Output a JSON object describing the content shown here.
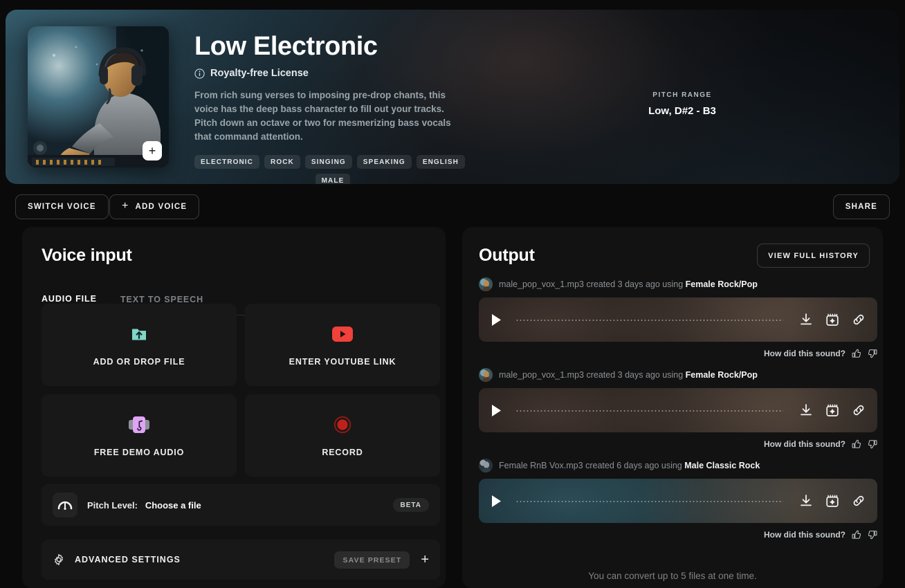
{
  "hero": {
    "cover_image_alt": "dj-producer-portrait",
    "cover_add_icon": "plus-icon",
    "title": "Low Electronic",
    "license_icon": "info-icon",
    "license": "Royalty-free License",
    "description": "From rich sung verses to imposing pre-drop chants, this voice has the deep bass character to fill out your tracks. Pitch down an octave or two for mesmerizing bass vocals that command attention.",
    "tags": [
      "ELECTRONIC",
      "ROCK",
      "SINGING",
      "SPEAKING",
      "ENGLISH"
    ],
    "tags_second_row": [
      "MALE"
    ],
    "pitch_range_label": "PITCH RANGE",
    "pitch_range_value": "Low, D#2 - B3"
  },
  "actions": {
    "switch_voice": "SWITCH VOICE",
    "add_voice": "ADD VOICE",
    "add_voice_icon": "plus-icon",
    "share": "SHARE"
  },
  "voice_input": {
    "title": "Voice input",
    "tabs": [
      {
        "label": "AUDIO FILE",
        "active": true
      },
      {
        "label": "TEXT TO SPEECH",
        "active": false
      }
    ],
    "cards": [
      {
        "label": "ADD OR DROP FILE",
        "icon": "upload-folder-icon",
        "color": "#7fd6c8"
      },
      {
        "label": "ENTER YOUTUBE LINK",
        "icon": "youtube-icon",
        "color": "#f0413a"
      },
      {
        "label": "FREE DEMO AUDIO",
        "icon": "cassette-music-icon",
        "color": "#dfa4f5"
      },
      {
        "label": "RECORD",
        "icon": "record-icon",
        "color": "#c0201a"
      }
    ],
    "pitch_level": {
      "icon": "gauge-icon",
      "label": "Pitch Level:",
      "value": "Choose a file",
      "badge": "BETA"
    },
    "advanced_settings": {
      "icon": "gear-icon",
      "label": "ADVANCED SETTINGS",
      "save_preset": "SAVE PRESET",
      "add_icon": "plus-icon"
    }
  },
  "output": {
    "title": "Output",
    "view_history": "VIEW FULL HISTORY",
    "feedback_label": "How did this sound?",
    "footer_note": "You can convert up to 5 files at one time.",
    "items": [
      {
        "file": "male_pop_vox_1.mp3",
        "created": "created 3 days ago using",
        "voice": "Female Rock/Pop",
        "theme": "warm",
        "avatar": "female-rock-avatar"
      },
      {
        "file": "male_pop_vox_1.mp3",
        "created": "created 3 days ago using",
        "voice": "Female Rock/Pop",
        "theme": "warm",
        "avatar": "female-rock-avatar"
      },
      {
        "file": "Female RnB Vox.mp3",
        "created": "created 6 days ago using",
        "voice": "Male Classic Rock",
        "theme": "cool",
        "avatar": "male-classic-rock-avatar"
      }
    ],
    "player_icons": {
      "play": "play-icon",
      "download": "download-icon",
      "studio": "add-to-studio-icon",
      "link": "copy-link-icon",
      "thumb_up": "thumbs-up-icon",
      "thumb_down": "thumbs-down-icon"
    }
  }
}
